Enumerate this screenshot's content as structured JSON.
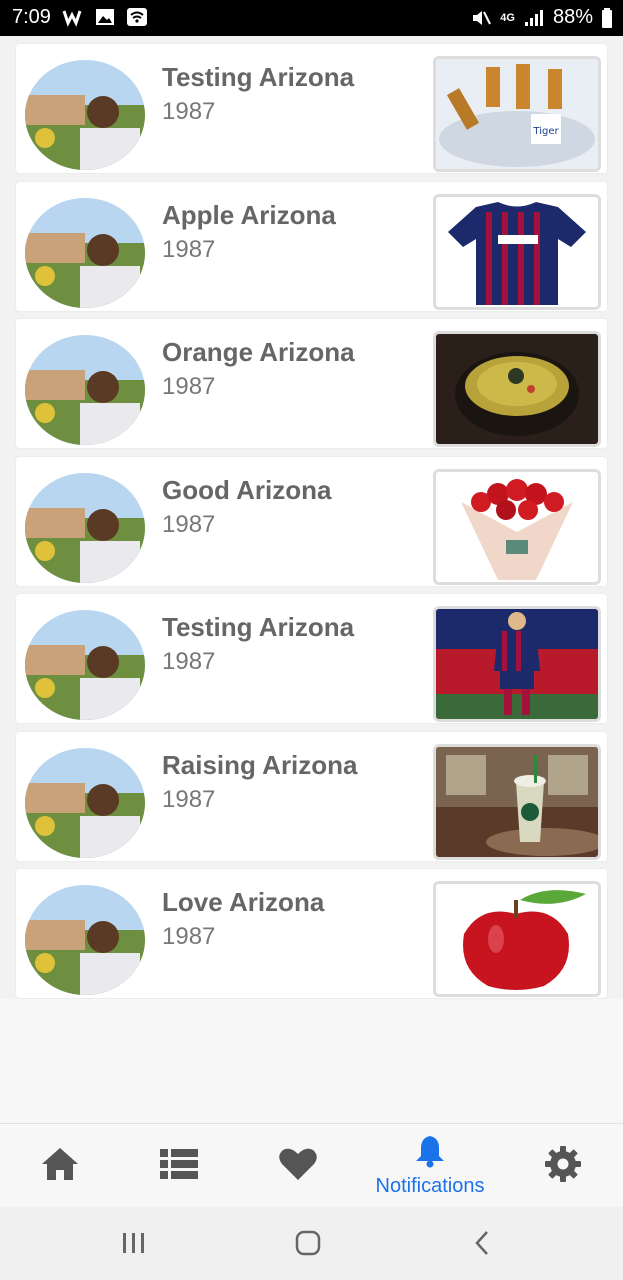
{
  "status_bar": {
    "time": "7:09",
    "battery": "88%",
    "network": "4G"
  },
  "items": [
    {
      "title": "Testing Arizona",
      "year": "1987",
      "thumbnail": "beer-bottles-ice-bucket"
    },
    {
      "title": "Apple Arizona",
      "year": "1987",
      "thumbnail": "striped-football-jersey"
    },
    {
      "title": "Orange Arizona",
      "year": "1987",
      "thumbnail": "curry-bowl"
    },
    {
      "title": "Good  Arizona",
      "year": "1987",
      "thumbnail": "red-rose-bouquet"
    },
    {
      "title": "Testing Arizona",
      "year": "1987",
      "thumbnail": "football-player"
    },
    {
      "title": "Raising Arizona",
      "year": "1987",
      "thumbnail": "iced-drink-cup"
    },
    {
      "title": "Love Arizona",
      "year": "1987",
      "thumbnail": "red-apple"
    }
  ],
  "tabs": [
    {
      "name": "home",
      "icon": "home-icon",
      "label": ""
    },
    {
      "name": "list",
      "icon": "list-icon",
      "label": ""
    },
    {
      "name": "favorites",
      "icon": "heart-icon",
      "label": ""
    },
    {
      "name": "notifications",
      "icon": "bell-icon",
      "label": "Notifications",
      "active": true
    },
    {
      "name": "settings",
      "icon": "gear-icon",
      "label": ""
    }
  ],
  "colors": {
    "accent": "#1a73e8",
    "tab_icon": "#555555",
    "title_text": "#666666"
  },
  "nav": [
    "recent-apps-icon",
    "home-button-icon",
    "back-icon"
  ]
}
